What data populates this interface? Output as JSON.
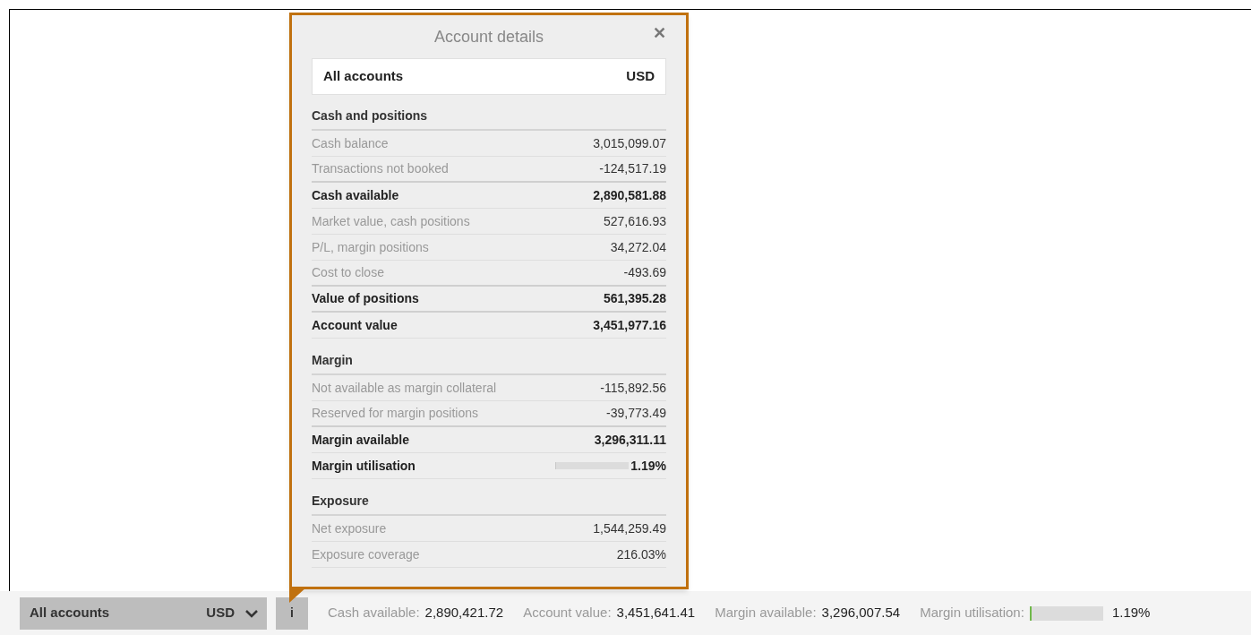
{
  "popup": {
    "title": "Account details",
    "close": "✕",
    "account": {
      "name": "All accounts",
      "currency": "USD"
    },
    "rows": [
      {
        "kind": "heading",
        "label": "Cash and positions"
      },
      {
        "kind": "detail",
        "label": "Cash balance",
        "value": "3,015,099.07"
      },
      {
        "kind": "detail",
        "label": "Transactions not booked",
        "value": "-124,517.19"
      },
      {
        "kind": "total",
        "label": "Cash available",
        "value": "2,890,581.88"
      },
      {
        "kind": "detail",
        "label": "Market value, cash positions",
        "value": "527,616.93"
      },
      {
        "kind": "detail",
        "label": "P/L, margin positions",
        "value": "34,272.04"
      },
      {
        "kind": "detail",
        "label": "Cost to close",
        "value": "-493.69"
      },
      {
        "kind": "total",
        "label": "Value of positions",
        "value": "561,395.28"
      },
      {
        "kind": "total",
        "label": "Account value",
        "value": "3,451,977.16"
      },
      {
        "kind": "heading",
        "label": "Margin"
      },
      {
        "kind": "detail",
        "label": "Not available as margin collateral",
        "value": "-115,892.56"
      },
      {
        "kind": "detail",
        "label": "Reserved for margin positions",
        "value": "-39,773.49"
      },
      {
        "kind": "total",
        "label": "Margin available",
        "value": "3,296,311.11"
      },
      {
        "kind": "meter",
        "label": "Margin utilisation",
        "value": "1.19%",
        "level": 0.0119
      },
      {
        "kind": "heading",
        "label": "Exposure"
      },
      {
        "kind": "detail",
        "label": "Net exposure",
        "value": "1,544,259.49"
      },
      {
        "kind": "detail",
        "label": "Exposure coverage",
        "value": "216.03%"
      }
    ]
  },
  "status_bar": {
    "account": "All accounts",
    "currency": "USD",
    "info": "i",
    "items": [
      {
        "kind": "text",
        "label": "Cash available:",
        "value": "2,890,421.72"
      },
      {
        "kind": "text",
        "label": "Account value:",
        "value": "3,451,641.41"
      },
      {
        "kind": "text",
        "label": "Margin available:",
        "value": "3,296,007.54"
      },
      {
        "kind": "meter",
        "label": "Margin utilisation:",
        "value": "1.19%",
        "level": 0.0119
      }
    ]
  }
}
